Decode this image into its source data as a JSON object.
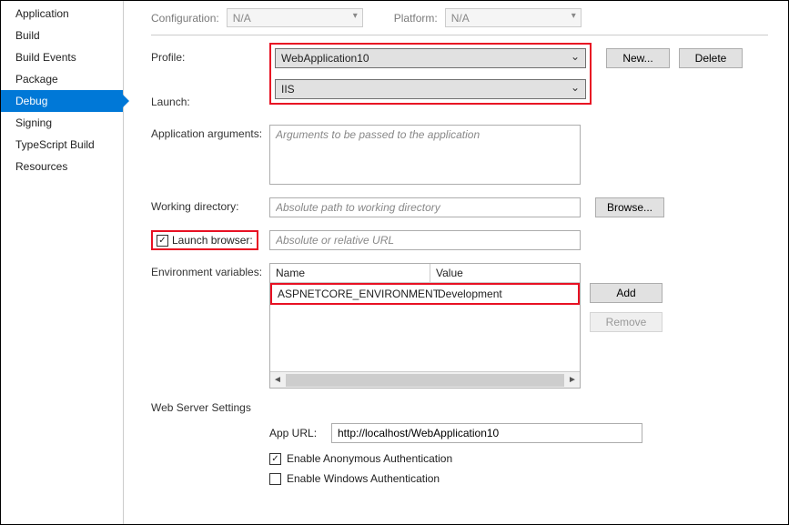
{
  "sidebar": {
    "items": [
      {
        "label": "Application"
      },
      {
        "label": "Build"
      },
      {
        "label": "Build Events"
      },
      {
        "label": "Package"
      },
      {
        "label": "Debug"
      },
      {
        "label": "Signing"
      },
      {
        "label": "TypeScript Build"
      },
      {
        "label": "Resources"
      }
    ]
  },
  "top": {
    "configuration_label": "Configuration:",
    "configuration_value": "N/A",
    "platform_label": "Platform:",
    "platform_value": "N/A"
  },
  "labels": {
    "profile": "Profile:",
    "launch": "Launch:",
    "app_args": "Application arguments:",
    "working_dir": "Working directory:",
    "launch_browser": "Launch browser:",
    "env_vars": "Environment variables:",
    "web_server": "Web Server Settings",
    "app_url": "App URL:",
    "enable_anon": "Enable Anonymous Authentication",
    "enable_win": "Enable Windows Authentication"
  },
  "buttons": {
    "new": "New...",
    "delete": "Delete",
    "browse": "Browse...",
    "add": "Add",
    "remove": "Remove"
  },
  "fields": {
    "profile_value": "WebApplication10",
    "launch_value": "IIS",
    "app_args_placeholder": "Arguments to be passed to the application",
    "working_dir_placeholder": "Absolute path to working directory",
    "launch_browser_placeholder": "Absolute or relative URL",
    "app_url_value": "http://localhost/WebApplication10"
  },
  "env_table": {
    "col_name": "Name",
    "col_value": "Value",
    "rows": [
      {
        "name": "ASPNETCORE_ENVIRONMENT",
        "value": "Development"
      }
    ]
  }
}
